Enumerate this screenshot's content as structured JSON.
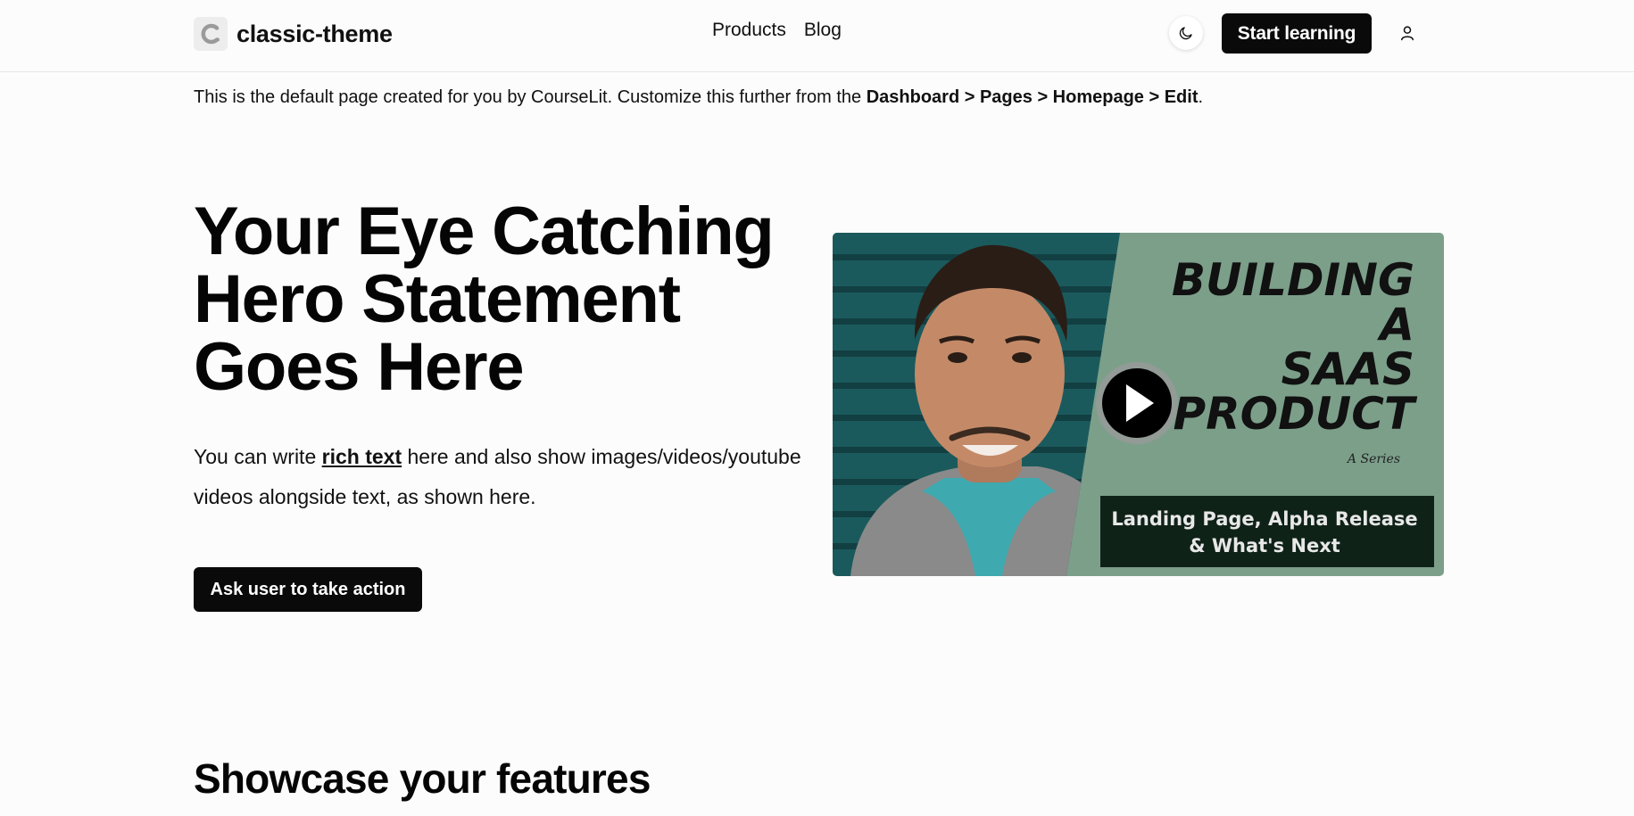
{
  "header": {
    "brand": "classic-theme",
    "nav": [
      "Products",
      "Blog"
    ],
    "start_label": "Start learning"
  },
  "notice": {
    "prefix": "This is the default page created for you by CourseLit. Customize this further from the ",
    "path": "Dashboard > Pages > Homepage > Edit",
    "suffix": "."
  },
  "hero": {
    "title": "Your Eye Catching Hero Statement Goes Here",
    "text_before": "You can write ",
    "text_link": "rich text",
    "text_after": " here and also show images/videos/youtube videos alongside text, as shown here.",
    "cta_label": "Ask user to take action"
  },
  "video": {
    "title_lines": [
      "BUILDING",
      "A",
      "SAAS",
      "PRODUCT"
    ],
    "series": "A Series",
    "subtitle_lines": [
      "Landing Page, Alpha Release",
      "& What's Next"
    ]
  },
  "features": {
    "title": "Showcase your features"
  }
}
